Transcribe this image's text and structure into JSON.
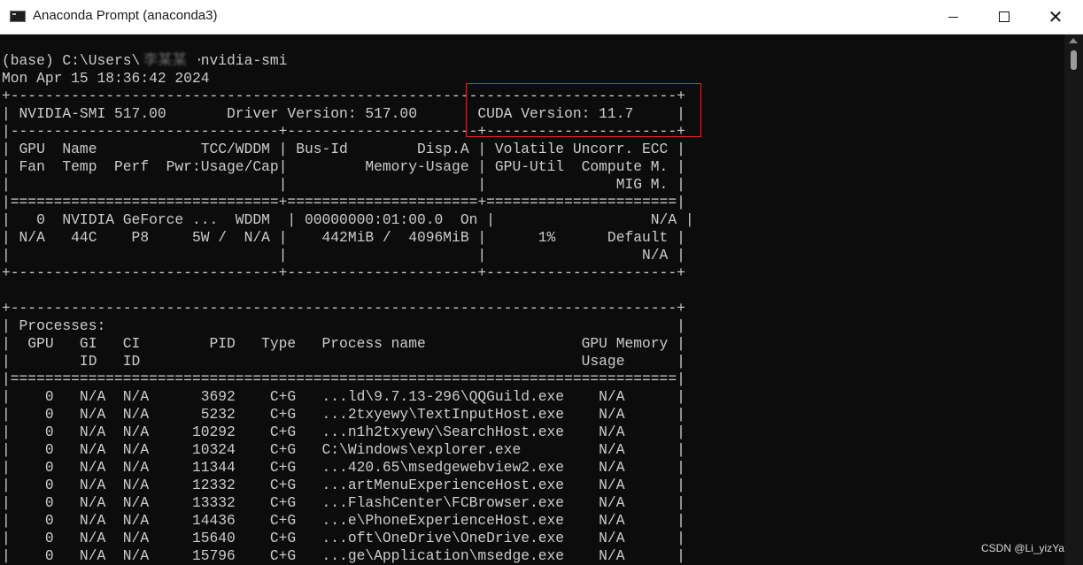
{
  "window": {
    "title": "Anaconda Prompt (anaconda3)",
    "minimize_symbol": "—",
    "maximize_symbol": "☐",
    "close_symbol": "✕"
  },
  "terminal": {
    "user_obscured": "李某某",
    "lines": [
      "(base) C:\\Users\\      >nvidia-smi",
      "Mon Apr 15 18:36:42 2024",
      "+-----------------------------------------------------------------------------+",
      "| NVIDIA-SMI 517.00       Driver Version: 517.00       CUDA Version: 11.7     |",
      "|-------------------------------+----------------------+----------------------+",
      "| GPU  Name            TCC/WDDM | Bus-Id        Disp.A | Volatile Uncorr. ECC |",
      "| Fan  Temp  Perf  Pwr:Usage/Cap|         Memory-Usage | GPU-Util  Compute M. |",
      "|                               |                      |               MIG M. |",
      "|===============================+======================+======================|",
      "|   0  NVIDIA GeForce ...  WDDM  | 00000000:01:00.0  On |                  N/A |",
      "| N/A   44C    P8     5W /  N/A |    442MiB /  4096MiB |      1%      Default |",
      "|                               |                      |                  N/A |",
      "+-------------------------------+----------------------+----------------------+",
      "",
      "+-----------------------------------------------------------------------------+",
      "| Processes:                                                                  |",
      "|  GPU   GI   CI        PID   Type   Process name                  GPU Memory |",
      "|        ID   ID                                                   Usage      |",
      "|=============================================================================|",
      "|    0   N/A  N/A      3692    C+G   ...ld\\9.7.13-296\\QQGuild.exe    N/A      |",
      "|    0   N/A  N/A      5232    C+G   ...2txyewy\\TextInputHost.exe    N/A      |",
      "|    0   N/A  N/A     10292    C+G   ...n1h2txyewy\\SearchHost.exe    N/A      |",
      "|    0   N/A  N/A     10324    C+G   C:\\Windows\\explorer.exe         N/A      |",
      "|    0   N/A  N/A     11344    C+G   ...420.65\\msedgewebview2.exe    N/A      |",
      "|    0   N/A  N/A     12332    C+G   ...artMenuExperienceHost.exe    N/A      |",
      "|    0   N/A  N/A     13332    C+G   ...FlashCenter\\FCBrowser.exe    N/A      |",
      "|    0   N/A  N/A     14436    C+G   ...e\\PhoneExperienceHost.exe    N/A      |",
      "|    0   N/A  N/A     15640    C+G   ...oft\\OneDrive\\OneDrive.exe    N/A      |",
      "|    0   N/A  N/A     15796    C+G   ...ge\\Application\\msedge.exe    N/A      |"
    ]
  },
  "watermark": "CSDN @Li_yizYa",
  "colors": {
    "console_bg": "#0c0c0c",
    "console_fg": "#cccccc",
    "highlight": "#e02424"
  }
}
